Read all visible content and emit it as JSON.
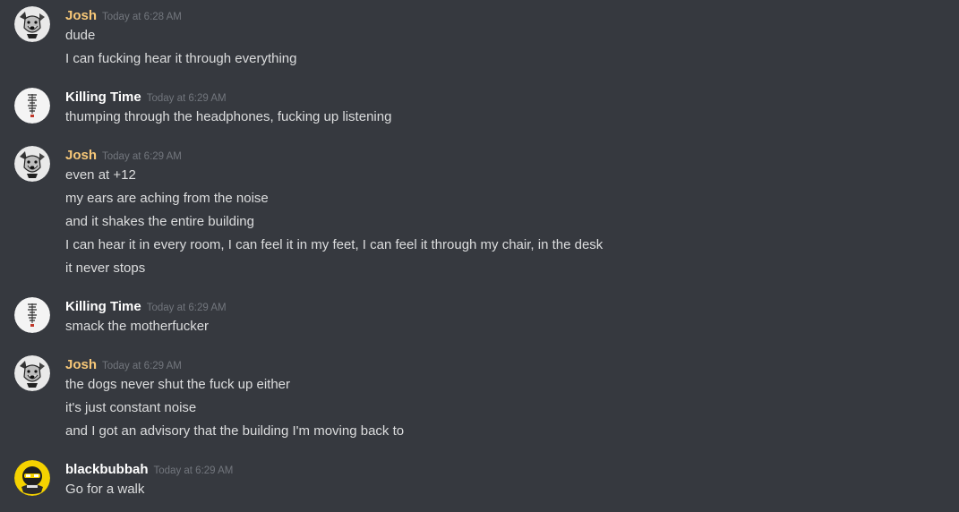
{
  "colors": {
    "background": "#36393f",
    "message_text": "#dcddde",
    "timestamp": "#72767d",
    "josh_name": "#f8c878",
    "default_name": "#ffffff"
  },
  "messages": [
    {
      "author": "Josh",
      "avatar_icon": "dog-avatar-icon",
      "timestamp": "Today at 6:28 AM",
      "lines": [
        "dude",
        "I can fucking hear it through everything"
      ]
    },
    {
      "author": "Killing Time",
      "avatar_icon": "calligraphy-avatar-icon",
      "timestamp": "Today at 6:29 AM",
      "lines": [
        "thumping through the headphones, fucking up listening"
      ]
    },
    {
      "author": "Josh",
      "avatar_icon": "dog-avatar-icon",
      "timestamp": "Today at 6:29 AM",
      "lines": [
        "even at +12",
        "my ears are aching from the noise",
        "and it shakes the entire building",
        "I can hear it in every room, I can feel it in my feet, I can feel it through my chair, in the desk",
        "it never stops"
      ]
    },
    {
      "author": "Killing Time",
      "avatar_icon": "calligraphy-avatar-icon",
      "timestamp": "Today at 6:29 AM",
      "lines": [
        "smack the motherfucker"
      ]
    },
    {
      "author": "Josh",
      "avatar_icon": "dog-avatar-icon",
      "timestamp": "Today at 6:29 AM",
      "lines": [
        "the dogs never shut the fuck up either",
        "it's just constant noise",
        "and I got an advisory that the building I'm moving back to"
      ]
    },
    {
      "author": "blackbubbah",
      "avatar_icon": "yellow-character-avatar-icon",
      "timestamp": "Today at 6:29 AM",
      "lines": [
        "Go for a walk"
      ]
    }
  ]
}
